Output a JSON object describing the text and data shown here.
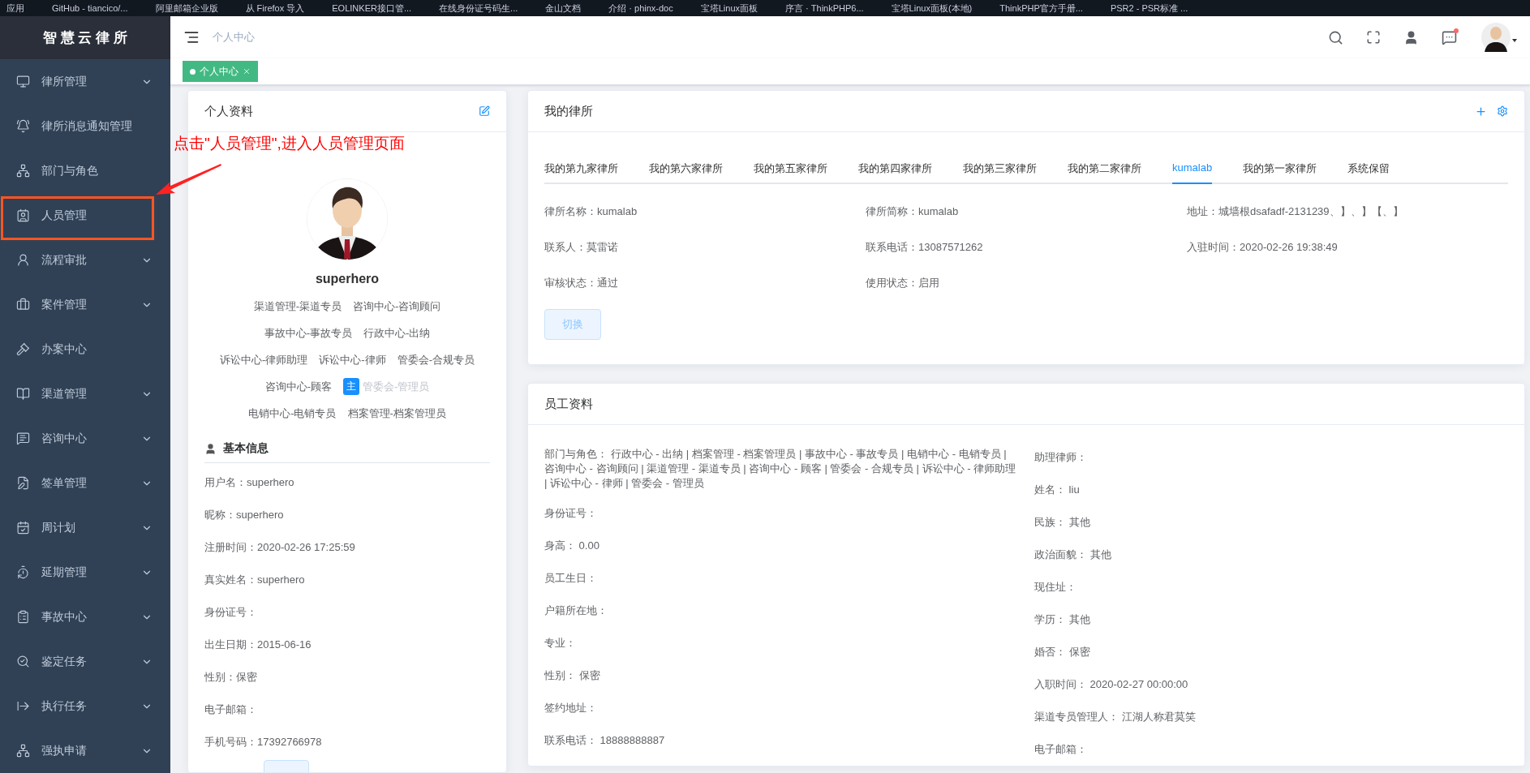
{
  "bookmarks": [
    "应用",
    "GitHub - tiancico/...",
    "阿里邮箱企业版",
    "从 Firefox 导入",
    "EOLINKER接口管...",
    "在线身份证号码生...",
    "金山文档",
    "介绍 · phinx-doc",
    "宝塔Linux面板",
    "序言 · ThinkPHP6...",
    "宝塔Linux面板(本地)",
    "ThinkPHP官方手册...",
    "PSR2 - PSR标准 ..."
  ],
  "sidebar": {
    "title": "智 慧 云 律 所",
    "items": [
      {
        "label": "律所管理",
        "submenu": true,
        "highlighted": false
      },
      {
        "label": "律所消息通知管理",
        "submenu": false,
        "highlighted": false
      },
      {
        "label": "部门与角色",
        "submenu": false,
        "highlighted": false
      },
      {
        "label": "人员管理",
        "submenu": false,
        "highlighted": true
      },
      {
        "label": "流程审批",
        "submenu": true,
        "highlighted": false
      },
      {
        "label": "案件管理",
        "submenu": true,
        "highlighted": false
      },
      {
        "label": "办案中心",
        "submenu": false,
        "highlighted": false
      },
      {
        "label": "渠道管理",
        "submenu": true,
        "highlighted": false
      },
      {
        "label": "咨询中心",
        "submenu": true,
        "highlighted": false
      },
      {
        "label": "签单管理",
        "submenu": true,
        "highlighted": false
      },
      {
        "label": "周计划",
        "submenu": true,
        "highlighted": false
      },
      {
        "label": "延期管理",
        "submenu": true,
        "highlighted": false
      },
      {
        "label": "事故中心",
        "submenu": true,
        "highlighted": false
      },
      {
        "label": "鉴定任务",
        "submenu": true,
        "highlighted": false
      },
      {
        "label": "执行任务",
        "submenu": true,
        "highlighted": false
      },
      {
        "label": "强执申请",
        "submenu": true,
        "highlighted": false
      }
    ]
  },
  "annotation": {
    "text": "点击\"人员管理\",进入人员管理页面"
  },
  "header": {
    "breadcrumb": "个人中心",
    "notification": true
  },
  "tags": [
    {
      "label": "个人中心",
      "selected": true
    }
  ],
  "profile": {
    "title": "个人资料",
    "username": "superhero",
    "roles": [
      {
        "label": "渠道管理-渠道专员"
      },
      {
        "label": "咨询中心-咨询顾问"
      },
      {
        "label": "事故中心-事故专员"
      },
      {
        "label": "行政中心-出纳"
      },
      {
        "label": "诉讼中心-律师助理"
      },
      {
        "label": "诉讼中心-律师"
      },
      {
        "label": "管委会-合规专员"
      },
      {
        "label": "咨询中心-顾客"
      },
      {
        "label": "管委会-管理员",
        "badge": "主"
      },
      {
        "label": "电销中心-电销专员"
      },
      {
        "label": "档案管理-档案管理员"
      }
    ],
    "section": "基本信息",
    "fields": [
      "用户名：superhero",
      "昵称：superhero",
      "注册时间：2020-02-26 17:25:59",
      "真实姓名：superhero",
      "身份证号：",
      "出生日期：2015-06-16",
      "性别：保密",
      "电子邮箱：",
      "手机号码：17392766978"
    ]
  },
  "firm": {
    "title": "我的律所",
    "tabs": [
      {
        "label": "我的第九家律所",
        "selected": false
      },
      {
        "label": "我的第六家律所",
        "selected": false
      },
      {
        "label": "我的第五家律所",
        "selected": false
      },
      {
        "label": "我的第四家律所",
        "selected": false
      },
      {
        "label": "我的第三家律所",
        "selected": false
      },
      {
        "label": "我的第二家律所",
        "selected": false
      },
      {
        "label": "kumalab",
        "selected": true
      },
      {
        "label": "我的第一家律所",
        "selected": false
      },
      {
        "label": "系统保留",
        "selected": false
      }
    ],
    "fields": [
      "律所名称：kumalab",
      "律所简称：kumalab",
      "地址：城墙根dsafadf-2131239、】、】【、】",
      "联系人：莫雷诺",
      "联系电话：13087571262",
      "入驻时间：2020-02-26 19:38:49",
      "审核状态：通过",
      "使用状态：启用"
    ],
    "button": {
      "label": "切换",
      "disabled": true
    }
  },
  "staff": {
    "title": "员工资料",
    "left": [
      "部门与角色： 行政中心 - 出纳 | 档案管理 - 档案管理员 | 事故中心 - 事故专员 | 电销中心 - 电销专员 | 咨询中心 - 咨询顾问 | 渠道管理 - 渠道专员 | 咨询中心 - 顾客 | 管委会 - 合规专员 | 诉讼中心 - 律师助理 | 诉讼中心 - 律师 | 管委会 - 管理员",
      "身份证号：",
      "身高： 0.00",
      "员工生日：",
      "户籍所在地：",
      "专业：",
      "性别： 保密",
      "签约地址：",
      "联系电话： 18888888887"
    ],
    "right": [
      "助理律师：",
      "姓名： liu",
      "民族： 其他",
      "政治面貌： 其他",
      "现住址：",
      "学历： 其他",
      "婚否： 保密",
      "入职时间： 2020-02-27 00:00:00",
      "渠道专员管理人： 江湖人称君莫笑",
      "电子邮箱："
    ]
  }
}
